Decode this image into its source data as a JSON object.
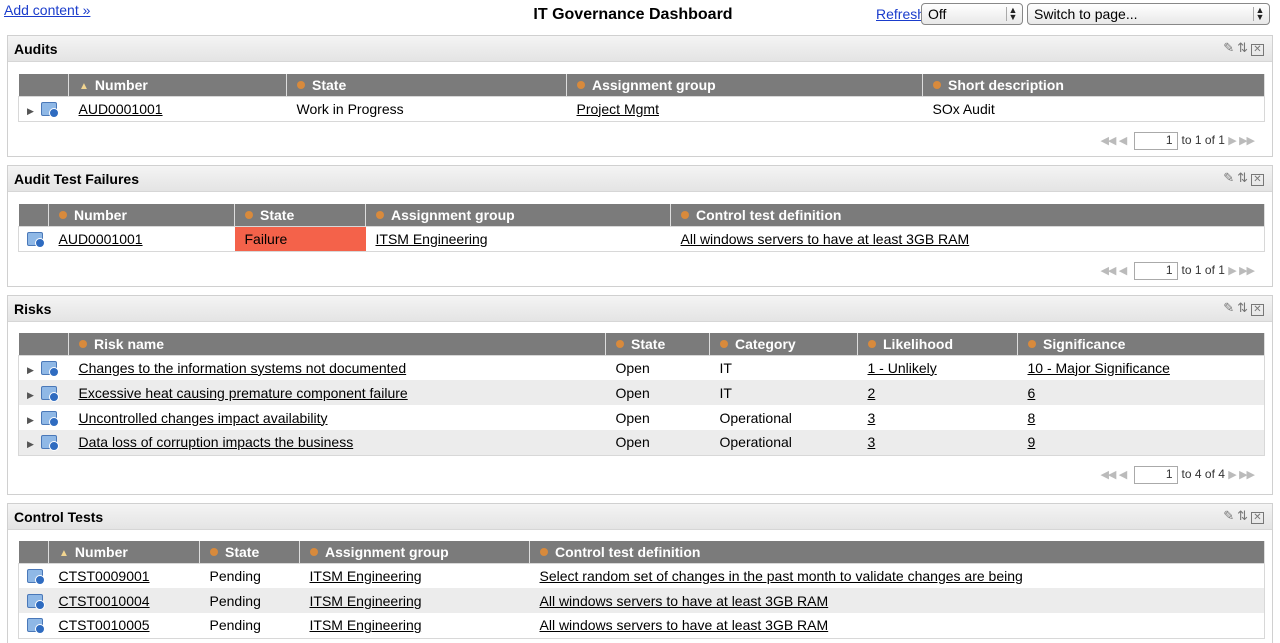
{
  "header": {
    "add_content": "Add content »",
    "title": "IT Governance Dashboard",
    "refresh": "Refresh",
    "refresh_value": "Off",
    "switch_page": "Switch to page..."
  },
  "audits": {
    "title": "Audits",
    "columns": [
      "Number",
      "State",
      "Assignment group",
      "Short description"
    ],
    "rows": [
      {
        "number": "AUD0001001",
        "state": "Work in Progress",
        "group": "Project Mgmt",
        "desc": "SOx Audit"
      }
    ],
    "pager": {
      "page": "1",
      "range": "to 1 of 1"
    }
  },
  "failures": {
    "title": "Audit Test Failures",
    "columns": [
      "Number",
      "State",
      "Assignment group",
      "Control test definition"
    ],
    "rows": [
      {
        "number": "AUD0001001",
        "state": "Failure",
        "group": "ITSM Engineering",
        "def": "All windows servers to have at least 3GB RAM"
      }
    ],
    "pager": {
      "page": "1",
      "range": "to 1 of 1"
    }
  },
  "risks": {
    "title": "Risks",
    "columns": [
      "Risk name",
      "State",
      "Category",
      "Likelihood",
      "Significance"
    ],
    "rows": [
      {
        "name": "Changes to the information systems not documented",
        "state": "Open",
        "category": "IT",
        "likelihood": "1 - Unlikely",
        "significance": "10 - Major Significance"
      },
      {
        "name": "Excessive heat causing premature component failure",
        "state": "Open",
        "category": "IT",
        "likelihood": "2",
        "significance": "6"
      },
      {
        "name": "Uncontrolled changes impact availability",
        "state": "Open",
        "category": "Operational",
        "likelihood": "3",
        "significance": "8"
      },
      {
        "name": "Data loss of corruption impacts the business",
        "state": "Open",
        "category": "Operational",
        "likelihood": "3",
        "significance": "9"
      }
    ],
    "pager": {
      "page": "1",
      "range": "to 4 of 4"
    }
  },
  "control_tests": {
    "title": "Control Tests",
    "columns": [
      "Number",
      "State",
      "Assignment group",
      "Control test definition"
    ],
    "rows": [
      {
        "number": "CTST0009001",
        "state": "Pending",
        "group": "ITSM Engineering",
        "def": "Select random set of changes in the past month to validate changes are being"
      },
      {
        "number": "CTST0010004",
        "state": "Pending",
        "group": "ITSM Engineering",
        "def": "All windows servers to have at least 3GB RAM"
      },
      {
        "number": "CTST0010005",
        "state": "Pending",
        "group": "ITSM Engineering",
        "def": "All windows servers to have at least 3GB RAM"
      }
    ]
  },
  "colors": {
    "header_bg": "#7b7b7b",
    "failure": "#f4624a",
    "link": "#1a3ccc"
  }
}
